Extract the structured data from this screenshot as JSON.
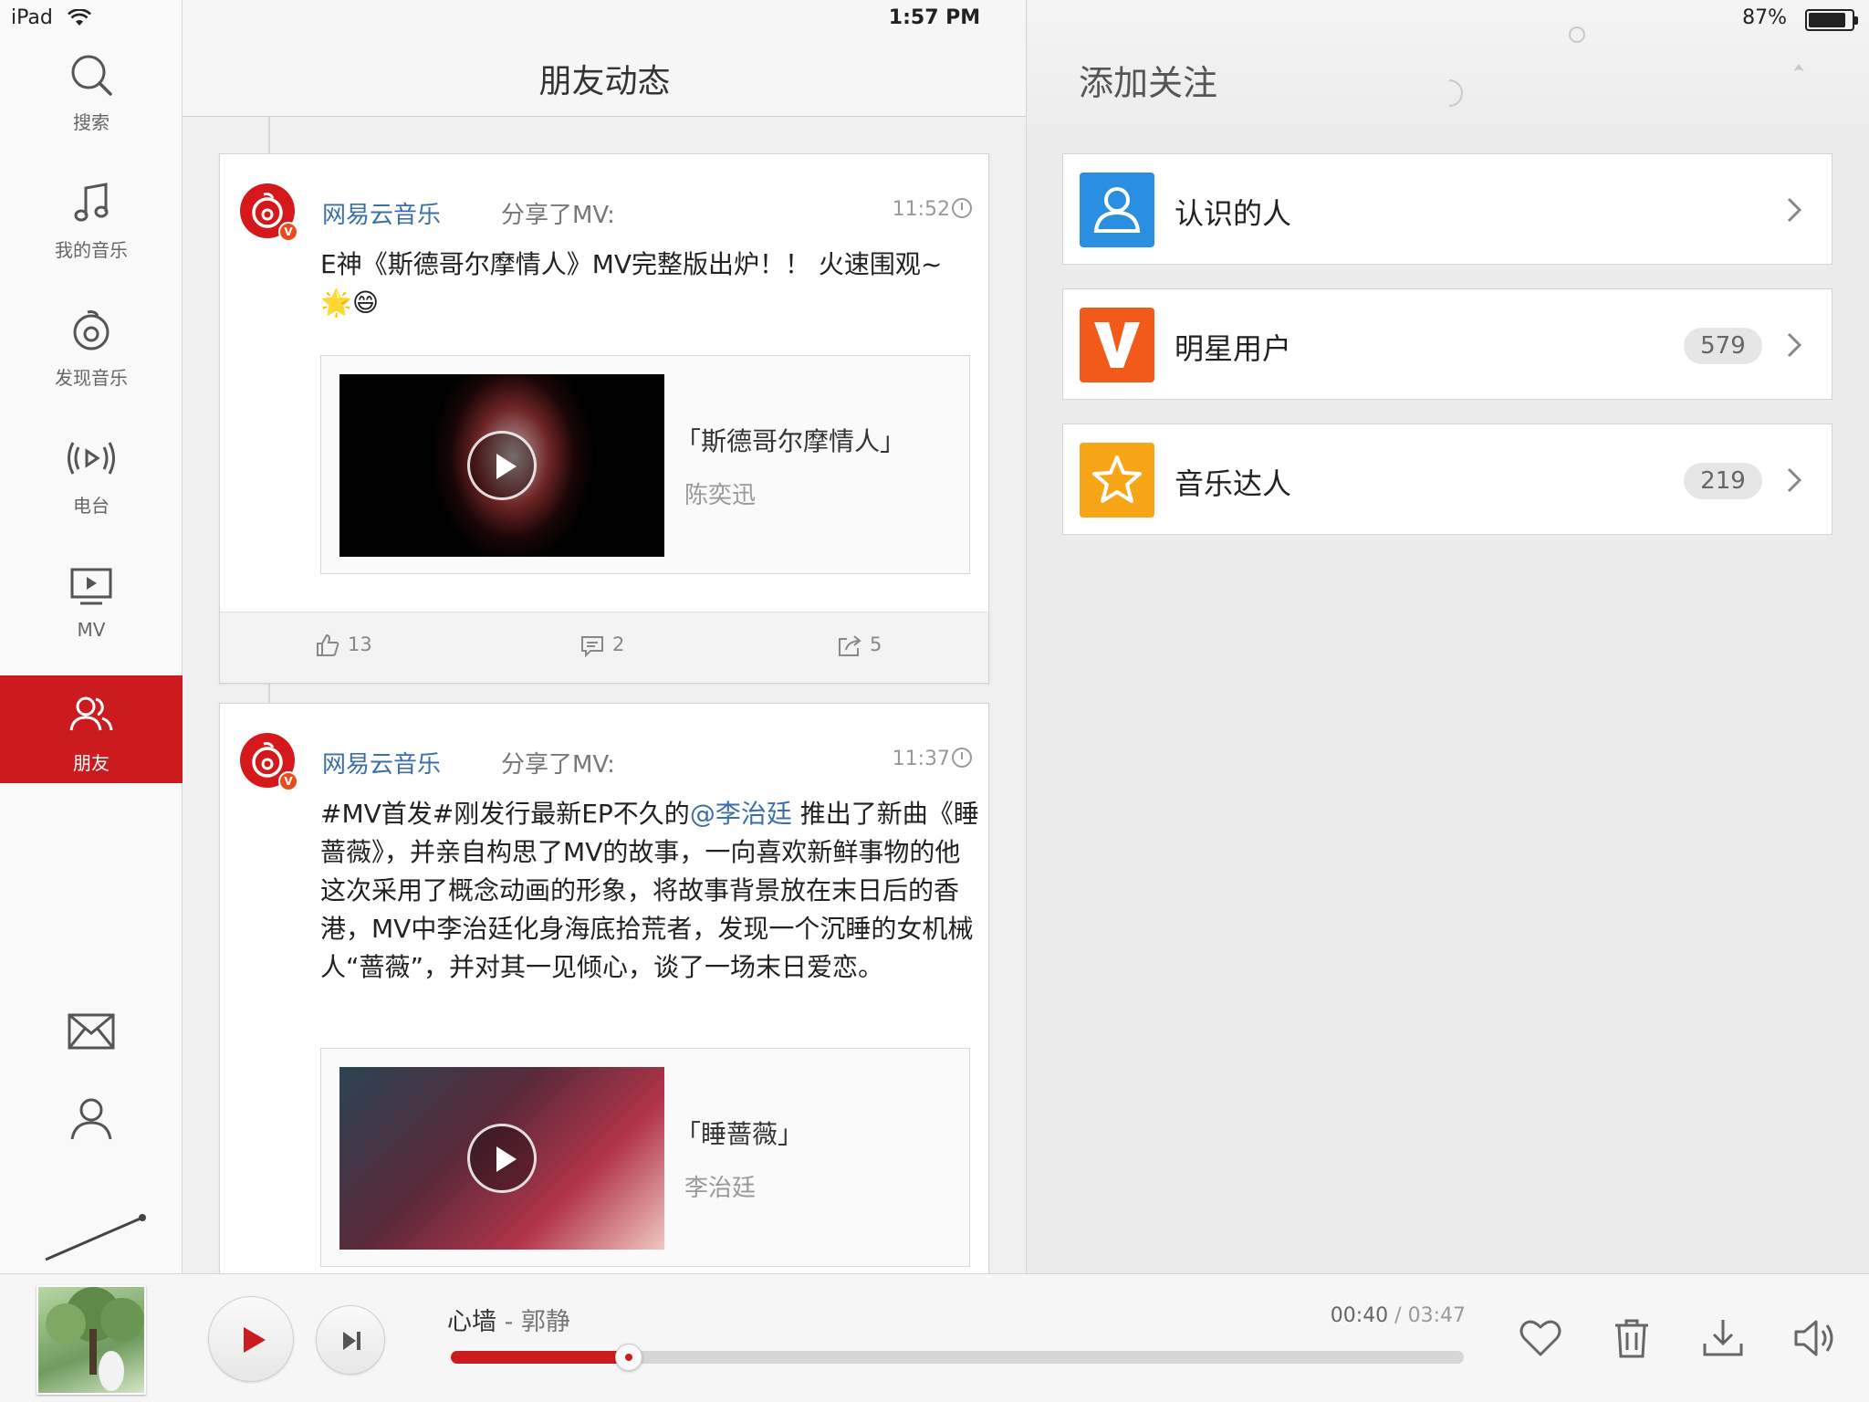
{
  "status_bar": {
    "carrier": "iPad",
    "time": "1:57 PM",
    "battery": "87%",
    "battery_level": 0.87
  },
  "sidebar": {
    "items": [
      {
        "label": "搜索",
        "icon": "search-icon"
      },
      {
        "label": "我的音乐",
        "icon": "music-note-icon"
      },
      {
        "label": "发现音乐",
        "icon": "netease-logo-icon"
      },
      {
        "label": "电台",
        "icon": "radio-icon"
      },
      {
        "label": "MV",
        "icon": "mv-icon"
      },
      {
        "label": "朋友",
        "icon": "friends-icon",
        "active": true
      }
    ],
    "bottom_icons": [
      "mail-icon",
      "profile-icon"
    ]
  },
  "feed": {
    "title": "朋友动态",
    "posts": [
      {
        "author": "网易云音乐",
        "action": "分享了MV:",
        "time": "11:52",
        "text": "E神《斯德哥尔摩情人》MV完整版出炉！！ 火速围观~",
        "emoji": "🌟😄",
        "mv_title": "「斯德哥尔摩情人」",
        "mv_artist": "陈奕迅",
        "likes": "13",
        "comments": "2",
        "shares": "5"
      },
      {
        "author": "网易云音乐",
        "action": "分享了MV:",
        "time": "11:37",
        "text_before": "#MV首发#刚发行最新EP不久的",
        "mention": "@李治廷",
        "text_after": " 推出了新曲《睡蔷薇》，并亲自构思了MV的故事，一向喜欢新鲜事物的他这次采用了概念动画的形象，将故事背景放在末日后的香港，MV中李治廷化身海底拾荒者，发现一个沉睡的女机械人“蔷薇”，并对其一见倾心，谈了一场末日爱恋。",
        "mv_title": "「睡蔷薇」",
        "mv_artist": "李治廷"
      }
    ]
  },
  "follow": {
    "title": "添加关注",
    "items": [
      {
        "label": "认识的人",
        "count": "",
        "icon": "person-icon",
        "color": "#2a8fe0"
      },
      {
        "label": "明星用户",
        "count": "579",
        "icon": "v-badge-icon",
        "color": "#f25a1c"
      },
      {
        "label": "音乐达人",
        "count": "219",
        "icon": "star-icon",
        "color": "#f5a515"
      }
    ]
  },
  "player": {
    "song": "心墙",
    "separator": " - ",
    "artist": "郭静",
    "current_time": "00:40",
    "time_separator": " / ",
    "total_time": "03:47",
    "progress": 0.176
  }
}
